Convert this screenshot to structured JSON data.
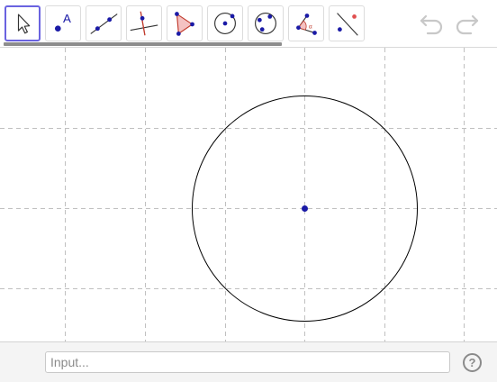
{
  "toolbar": {
    "tools": [
      {
        "name": "move",
        "icon": "move-cursor-icon",
        "selected": true
      },
      {
        "name": "point",
        "icon": "point-icon",
        "label": "A"
      },
      {
        "name": "line",
        "icon": "line-icon"
      },
      {
        "name": "perpendicular-line",
        "icon": "perpendicular-line-icon"
      },
      {
        "name": "polygon",
        "icon": "polygon-icon"
      },
      {
        "name": "circle-center-point",
        "icon": "circle-center-point-icon"
      },
      {
        "name": "circle-three-points",
        "icon": "circle-three-points-icon"
      },
      {
        "name": "angle",
        "icon": "angle-icon"
      },
      {
        "name": "reflect",
        "icon": "reflect-icon"
      }
    ],
    "undo_icon": "undo-icon",
    "redo_icon": "redo-icon"
  },
  "input_bar": {
    "placeholder": "Input...",
    "help_label": "?"
  },
  "colors": {
    "selected_tool_border": "#6a63e0",
    "point": "#1a1aa6",
    "grid": "#c0c0c0",
    "circle": "#000000",
    "polygon_fill": "#f4c2c2",
    "polygon_stroke": "#c0392b"
  }
}
